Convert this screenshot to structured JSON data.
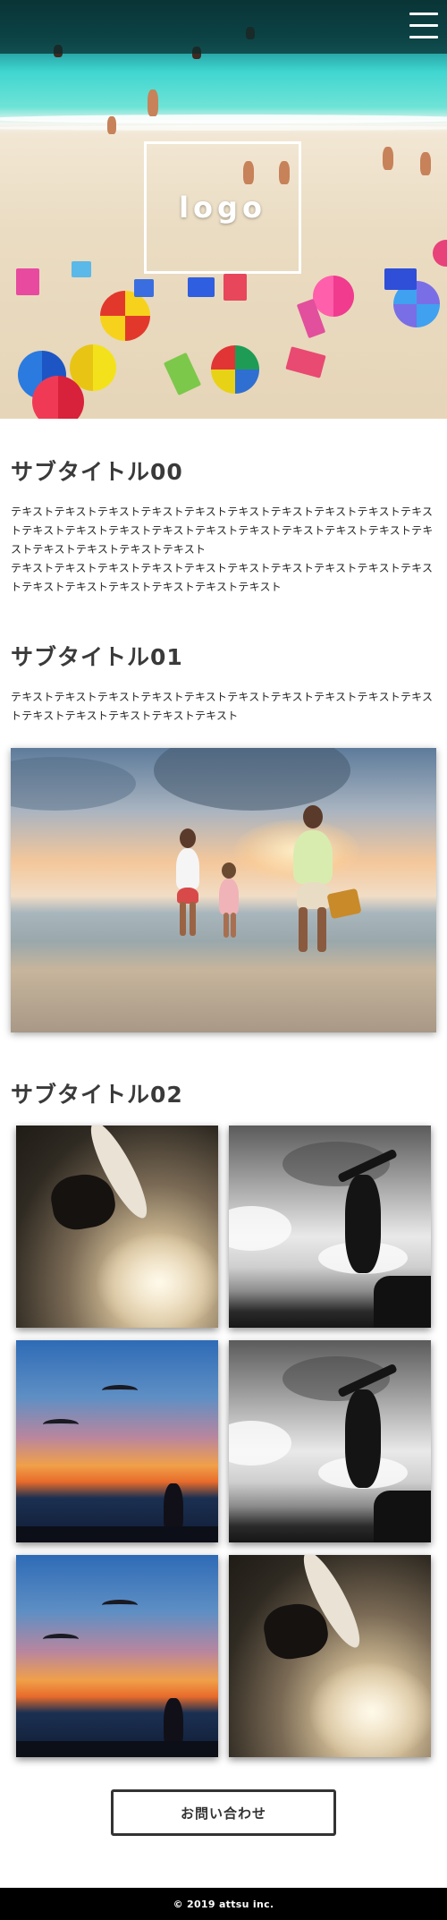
{
  "header": {
    "logo_text": "logo",
    "menu_icon": "hamburger-menu-icon"
  },
  "sections": [
    {
      "title": "サブタイトル00",
      "paragraphs": [
        "テキストテキストテキストテキストテキストテキストテキストテキストテキストテキストテキストテキストテキストテキストテキストテキストテキストテキストテキストテキストテキストテキストテキストテキスト",
        "テキストテキストテキストテキストテキストテキストテキストテキストテキストテキストテキストテキストテキストテキストテキストテキスト"
      ]
    },
    {
      "title": "サブタイトル01",
      "paragraphs": [
        "テキストテキストテキストテキストテキストテキストテキストテキストテキストテキストテキストテキストテキストテキストテキスト"
      ]
    },
    {
      "title": "サブタイトル02"
    }
  ],
  "gallery": [
    {
      "kind": "surf",
      "subject": "surfer-photo"
    },
    {
      "kind": "bw",
      "subject": "jumper-photo"
    },
    {
      "kind": "dusk",
      "subject": "paraglider-sunset-photo"
    },
    {
      "kind": "bw",
      "subject": "jumper-photo"
    },
    {
      "kind": "dusk",
      "subject": "paraglider-sunset-photo"
    },
    {
      "kind": "surf",
      "subject": "surfer-photo"
    }
  ],
  "contact_button": {
    "label": "お問い合わせ"
  },
  "footer": {
    "copyright": "© 2019 attsu inc."
  },
  "colors": {
    "text": "#333333",
    "footer_bg": "#000000",
    "footer_text": "#ffffff",
    "topbar": "#0b3b3b"
  }
}
